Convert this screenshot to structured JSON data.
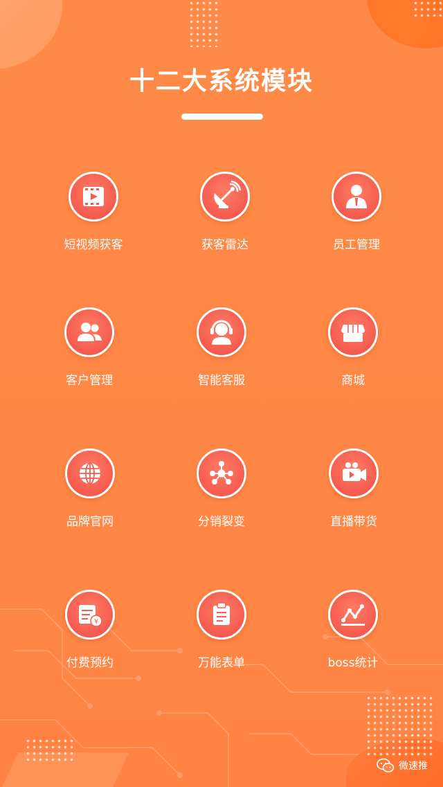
{
  "header": {
    "title": "十二大系统模块"
  },
  "modules": [
    {
      "label": "短视频获客",
      "icon": "video-icon"
    },
    {
      "label": "获客雷达",
      "icon": "radar-icon"
    },
    {
      "label": "员工管理",
      "icon": "employee-icon"
    },
    {
      "label": "客户管理",
      "icon": "customers-icon"
    },
    {
      "label": "智能客服",
      "icon": "headset-icon"
    },
    {
      "label": "商城",
      "icon": "store-icon"
    },
    {
      "label": "品牌官网",
      "icon": "globe-icon"
    },
    {
      "label": "分销裂变",
      "icon": "network-icon"
    },
    {
      "label": "直播带货",
      "icon": "camera-icon"
    },
    {
      "label": "付费预约",
      "icon": "booking-icon"
    },
    {
      "label": "万能表单",
      "icon": "clipboard-icon"
    },
    {
      "label": "boss统计",
      "icon": "stats-icon"
    }
  ],
  "watermark": {
    "text": "微速推",
    "icon": "wechat-icon"
  },
  "colors": {
    "background": "#ff8a47",
    "icon_circle": "#f55b4f",
    "text": "#ffffff"
  }
}
